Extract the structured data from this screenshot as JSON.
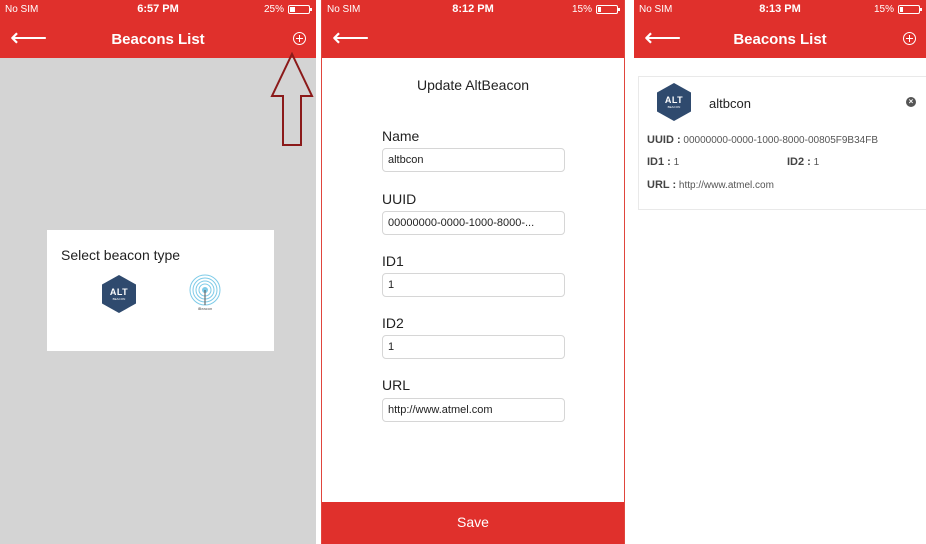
{
  "screen1": {
    "status": {
      "carrier": "No SIM",
      "time": "6:57 PM",
      "battery": "25%",
      "battery_level": 0.25
    },
    "nav": {
      "title": "Beacons List"
    },
    "dialog": {
      "title": "Select beacon type",
      "alt_logo": {
        "main": "ALT",
        "sub": "BEACON"
      },
      "ibeacon_label": "iBeacon"
    }
  },
  "screen2": {
    "status": {
      "carrier": "No SIM",
      "time": "8:12 PM",
      "battery": "15%",
      "battery_level": 0.15
    },
    "form_title": "Update AltBeacon",
    "fields": {
      "name": {
        "label": "Name",
        "value": "altbcon"
      },
      "uuid": {
        "label": "UUID",
        "value": "00000000-0000-1000-8000-..."
      },
      "id1": {
        "label": "ID1",
        "value": "1"
      },
      "id2": {
        "label": "ID2",
        "value": "1"
      },
      "url": {
        "label": "URL",
        "value": "http://www.atmel.com"
      }
    },
    "save_label": "Save"
  },
  "screen3": {
    "status": {
      "carrier": "No SIM",
      "time": "8:13 PM",
      "battery": "15%",
      "battery_level": 0.15
    },
    "nav": {
      "title": "Beacons List"
    },
    "beacon": {
      "alt_logo": {
        "main": "ALT",
        "sub": "BEACON"
      },
      "name": "altbcon",
      "uuid_key": "UUID :",
      "uuid": "00000000-0000-1000-8000-00805F9B34FB",
      "id1_key": "ID1 :",
      "id1": "1",
      "id2_key": "ID2 :",
      "id2": "1",
      "url_key": "URL :",
      "url": "http://www.atmel.com"
    }
  },
  "icons": {
    "back": "arrow-left-icon",
    "add": "circle-plus-icon",
    "remove": "circle-x-icon",
    "annotation": "arrow-up-outline",
    "beacon": "ibeacon-icon",
    "alt": "altbeacon-hexagon-logo"
  },
  "colors": {
    "brand_red": "#e0302c",
    "annotation_arrow": "#8b1a1a",
    "alt_logo": "#2f4a6e",
    "background_gray": "#d4d4d4"
  }
}
